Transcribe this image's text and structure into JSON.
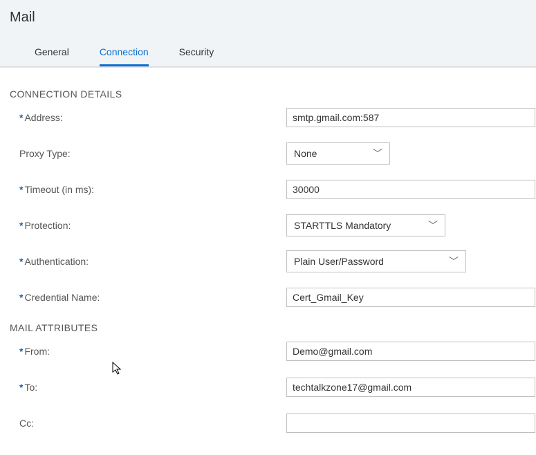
{
  "header": {
    "title": "Mail"
  },
  "tabs": {
    "items": [
      {
        "label": "General",
        "active": false
      },
      {
        "label": "Connection",
        "active": true
      },
      {
        "label": "Security",
        "active": false
      }
    ]
  },
  "sections": {
    "connection_details": {
      "title": "CONNECTION DETAILS",
      "address": {
        "label": "Address:",
        "required": true,
        "value": "smtp.gmail.com:587"
      },
      "proxy_type": {
        "label": "Proxy Type:",
        "required": false,
        "value": "None"
      },
      "timeout": {
        "label": "Timeout (in ms):",
        "required": true,
        "value": "30000"
      },
      "protection": {
        "label": "Protection:",
        "required": true,
        "value": "STARTTLS Mandatory"
      },
      "authentication": {
        "label": "Authentication:",
        "required": true,
        "value": "Plain User/Password"
      },
      "credential_name": {
        "label": "Credential Name:",
        "required": true,
        "value": "Cert_Gmail_Key"
      }
    },
    "mail_attributes": {
      "title": "MAIL ATTRIBUTES",
      "from": {
        "label": "From:",
        "required": true,
        "value": "Demo@gmail.com"
      },
      "to": {
        "label": "To:",
        "required": true,
        "value": "techtalkzone17@gmail.com"
      },
      "cc": {
        "label": "Cc:",
        "required": false,
        "value": ""
      }
    }
  },
  "glyphs": {
    "asterisk": "*",
    "chevron_down": "﹀"
  }
}
